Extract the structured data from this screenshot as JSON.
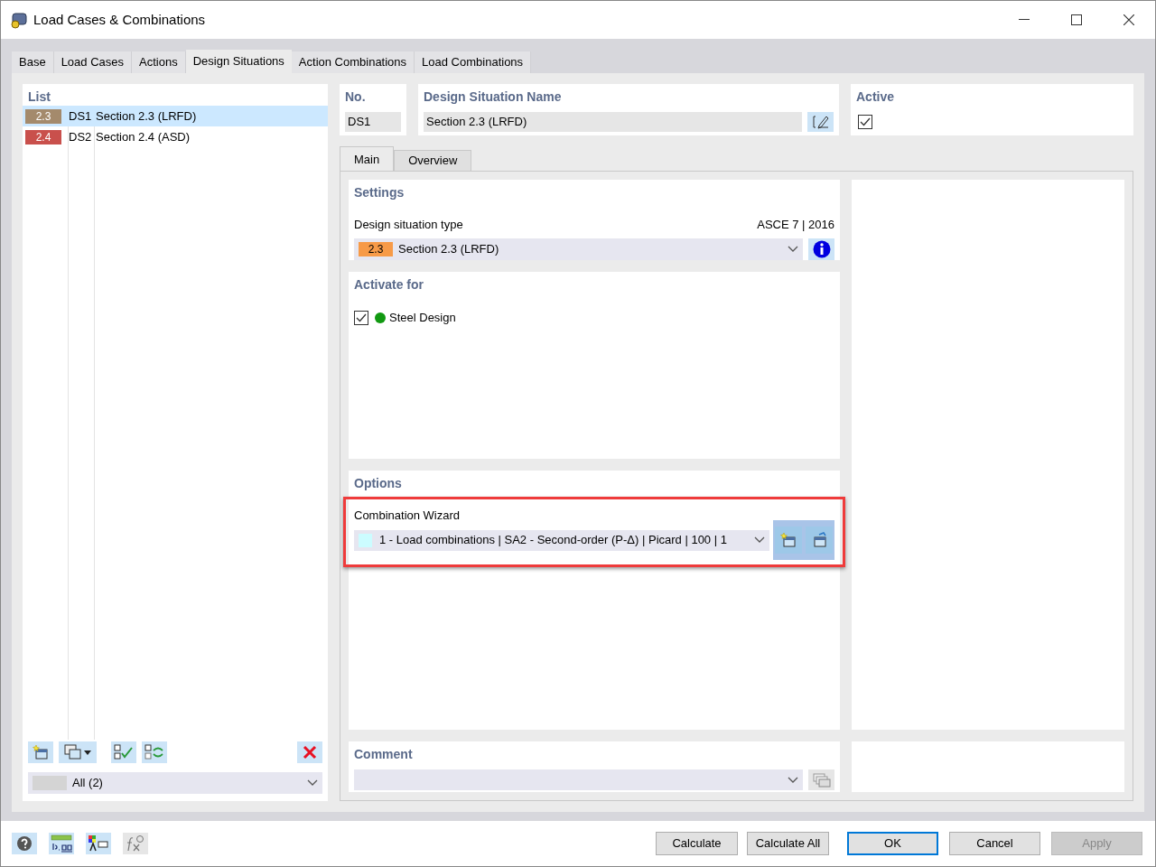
{
  "window": {
    "title": "Load Cases & Combinations"
  },
  "tabs": [
    {
      "label": "Base",
      "selected": false
    },
    {
      "label": "Load Cases",
      "selected": false
    },
    {
      "label": "Actions",
      "selected": false
    },
    {
      "label": "Design Situations",
      "selected": true
    },
    {
      "label": "Action Combinations",
      "selected": false
    },
    {
      "label": "Load Combinations",
      "selected": false
    }
  ],
  "list": {
    "title": "List",
    "items": [
      {
        "code": "2.3",
        "color": "#a48a6c",
        "id": "DS1",
        "name": "Section 2.3 (LRFD)",
        "selected": true
      },
      {
        "code": "2.4",
        "color": "#c9504c",
        "id": "DS2",
        "name": "Section 2.4 (ASD)",
        "selected": false
      }
    ],
    "filter": {
      "value": "All (2)"
    }
  },
  "number": {
    "label": "No.",
    "value": "DS1"
  },
  "name": {
    "label": "Design Situation Name",
    "value": "Section 2.3 (LRFD)"
  },
  "active": {
    "label": "Active",
    "checked": true
  },
  "subtabs": [
    {
      "label": "Main",
      "selected": true
    },
    {
      "label": "Overview",
      "selected": false
    }
  ],
  "settings": {
    "title": "Settings",
    "field_label": "Design situation type",
    "standard": "ASCE 7 | 2016",
    "type": {
      "code": "2.3",
      "color": "#f79a48",
      "value": "Section 2.3 (LRFD)"
    }
  },
  "activate_for": {
    "title": "Activate for",
    "items": [
      {
        "label": "Steel Design",
        "checked": true,
        "color": "#119911"
      }
    ]
  },
  "options": {
    "title": "Options",
    "wizard": {
      "label": "Combination Wizard",
      "value": "1 - Load combinations | SA2 - Second-order (P-Δ) | Picard | 100 | 1",
      "color": "#ccfcff"
    }
  },
  "comment": {
    "title": "Comment"
  },
  "buttons": [
    {
      "label": "Calculate",
      "focused": false,
      "disabled": false
    },
    {
      "label": "Calculate All",
      "focused": false,
      "disabled": false
    },
    {
      "label": "OK",
      "focused": true,
      "disabled": false
    },
    {
      "label": "Cancel",
      "focused": false,
      "disabled": false
    },
    {
      "label": "Apply",
      "focused": false,
      "disabled": true
    }
  ]
}
